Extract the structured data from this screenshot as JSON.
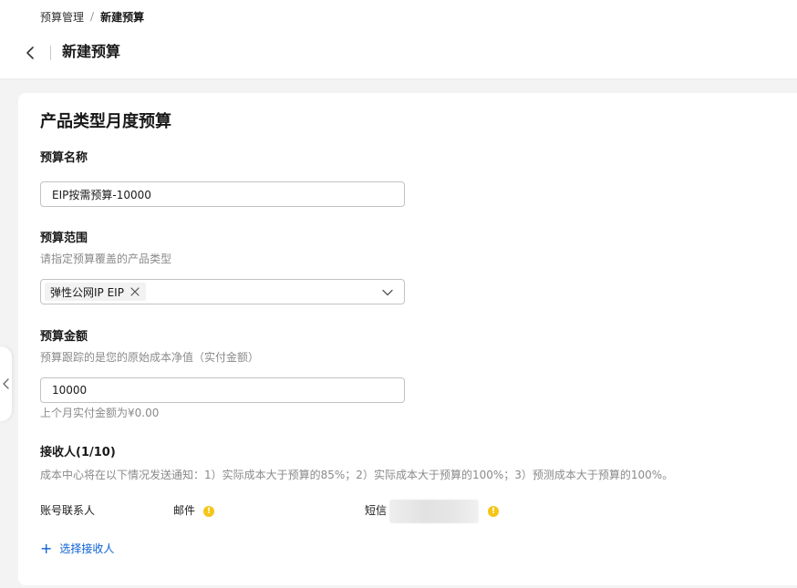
{
  "breadcrumb": {
    "parent": "预算管理",
    "separator": "/",
    "current": "新建预算"
  },
  "page": {
    "title": "新建预算"
  },
  "form": {
    "section_title": "产品类型月度预算",
    "name": {
      "label": "预算名称",
      "value": "EIP按需预算-10000"
    },
    "scope": {
      "label": "预算范围",
      "description": "请指定预算覆盖的产品类型",
      "selected_tag": "弹性公网IP EIP"
    },
    "amount": {
      "label": "预算金额",
      "description": "预算跟踪的是您的原始成本净值（实付金额）",
      "value": "10000",
      "hint": "上个月实付金额为¥0.00"
    },
    "recipients": {
      "label": "接收人(1/10)",
      "description": "成本中心将在以下情况发送通知：1）实际成本大于预算的85%；2）实际成本大于预算的100%；3）预测成本大于预算的100%。",
      "rows": [
        {
          "name": "账号联系人",
          "email_label": "邮件",
          "sms_label": "短信"
        }
      ],
      "add_label": "选择接收人"
    }
  },
  "colors": {
    "link": "#0a5fd6",
    "warning_icon": "#f5c518"
  }
}
